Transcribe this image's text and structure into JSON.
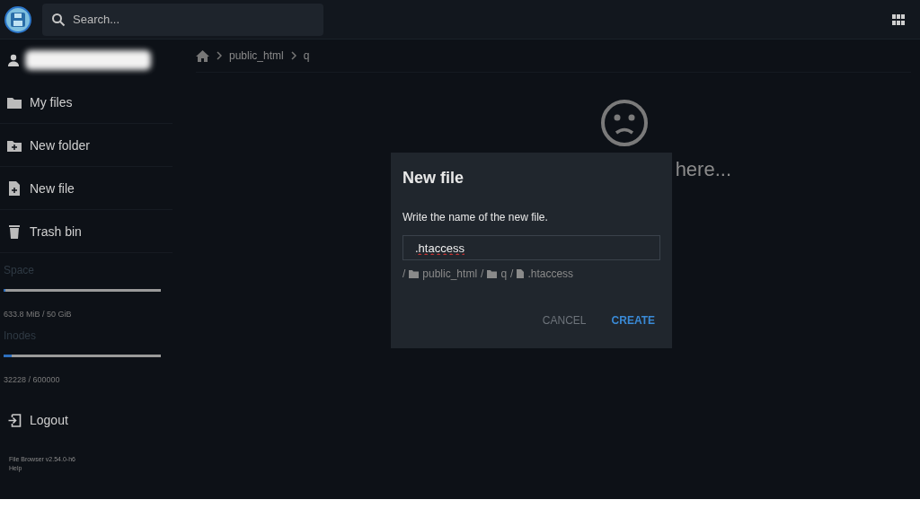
{
  "search": {
    "placeholder": "Search..."
  },
  "sidebar": {
    "items": [
      {
        "label": "My files",
        "kind": "folder"
      },
      {
        "label": "New folder",
        "kind": "new-folder"
      },
      {
        "label": "New file",
        "kind": "new-file"
      },
      {
        "label": "Trash bin",
        "kind": "trash"
      }
    ],
    "usage": [
      {
        "title": "Space",
        "level": 0.013,
        "reading": "633.8 MiB / 50 GiB"
      },
      {
        "title": "Inodes",
        "level": 0.054,
        "reading": "32228 / 600000"
      }
    ],
    "logout": "Logout",
    "version": "File Browser v2.54.0-h6",
    "help": "Help"
  },
  "breadcrumbs": [
    "public_html",
    "q"
  ],
  "empty_message": "here...",
  "dialog": {
    "title": "New file",
    "text": "Write the name of the new file.",
    "value": ".htaccess",
    "separator": "/",
    "path": [
      {
        "kind": "folder",
        "label": "public_html"
      },
      {
        "kind": "folder",
        "label": "q"
      },
      {
        "kind": "file",
        "label": ".htaccess"
      }
    ],
    "buttons": [
      {
        "label": "CANCEL",
        "kind": "secondary"
      },
      {
        "label": "CREATE",
        "kind": "primary"
      }
    ]
  }
}
